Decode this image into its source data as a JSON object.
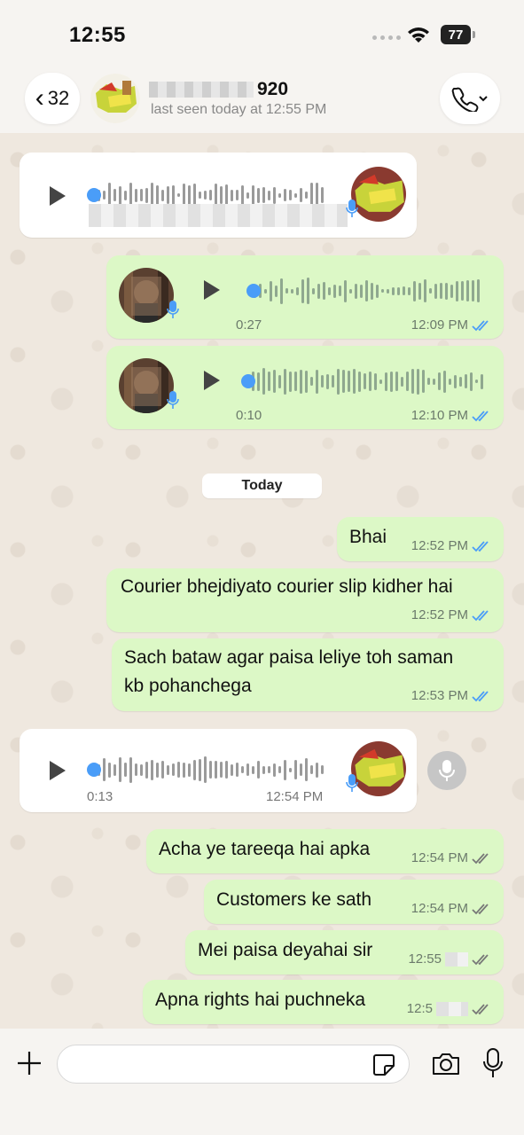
{
  "status": {
    "time": "12:55",
    "battery": "77"
  },
  "header": {
    "back_count": "32",
    "contact_name_visible": "920",
    "last_seen": "last seen today at 12:55 PM"
  },
  "date_separator": "Today",
  "voice_messages": [
    {
      "direction": "in",
      "duration": "",
      "time": ""
    },
    {
      "direction": "out",
      "duration": "0:27",
      "time": "12:09 PM",
      "status": "read"
    },
    {
      "direction": "out",
      "duration": "0:10",
      "time": "12:10 PM",
      "status": "read"
    },
    {
      "direction": "in",
      "duration": "0:13",
      "time": "12:54 PM"
    }
  ],
  "text_messages": [
    {
      "text": "Bhai",
      "time": "12:52 PM",
      "status": "read"
    },
    {
      "text": "Courier bhejdiyato courier slip kidher hai",
      "time": "12:52 PM",
      "status": "read"
    },
    {
      "line1": "Sach bataw agar paisa leliye toh saman",
      "line2": "kb pohanchega",
      "time": "12:53 PM",
      "status": "read"
    },
    {
      "text": "Acha ye tareeqa hai apka",
      "time": "12:54 PM",
      "status": "delivered"
    },
    {
      "text": "Customers ke sath",
      "time": "12:54 PM",
      "status": "delivered"
    },
    {
      "text": "Mei paisa deyahai sir",
      "time": "12:55",
      "status": "delivered"
    },
    {
      "text": "Apna rights hai puchneka",
      "time": "12:5",
      "status": "delivered"
    }
  ],
  "input": {
    "placeholder": ""
  },
  "colors": {
    "outgoing_bubble": "#dcf8c6",
    "incoming_bubble": "#ffffff",
    "read_tick": "#4a9df8",
    "delivered_tick": "#7a7a7a"
  },
  "icons": [
    "back-chevron-icon",
    "phone-icon",
    "play-icon",
    "mic-icon",
    "plus-icon",
    "sticker-icon",
    "camera-icon",
    "double-check-icon"
  ]
}
